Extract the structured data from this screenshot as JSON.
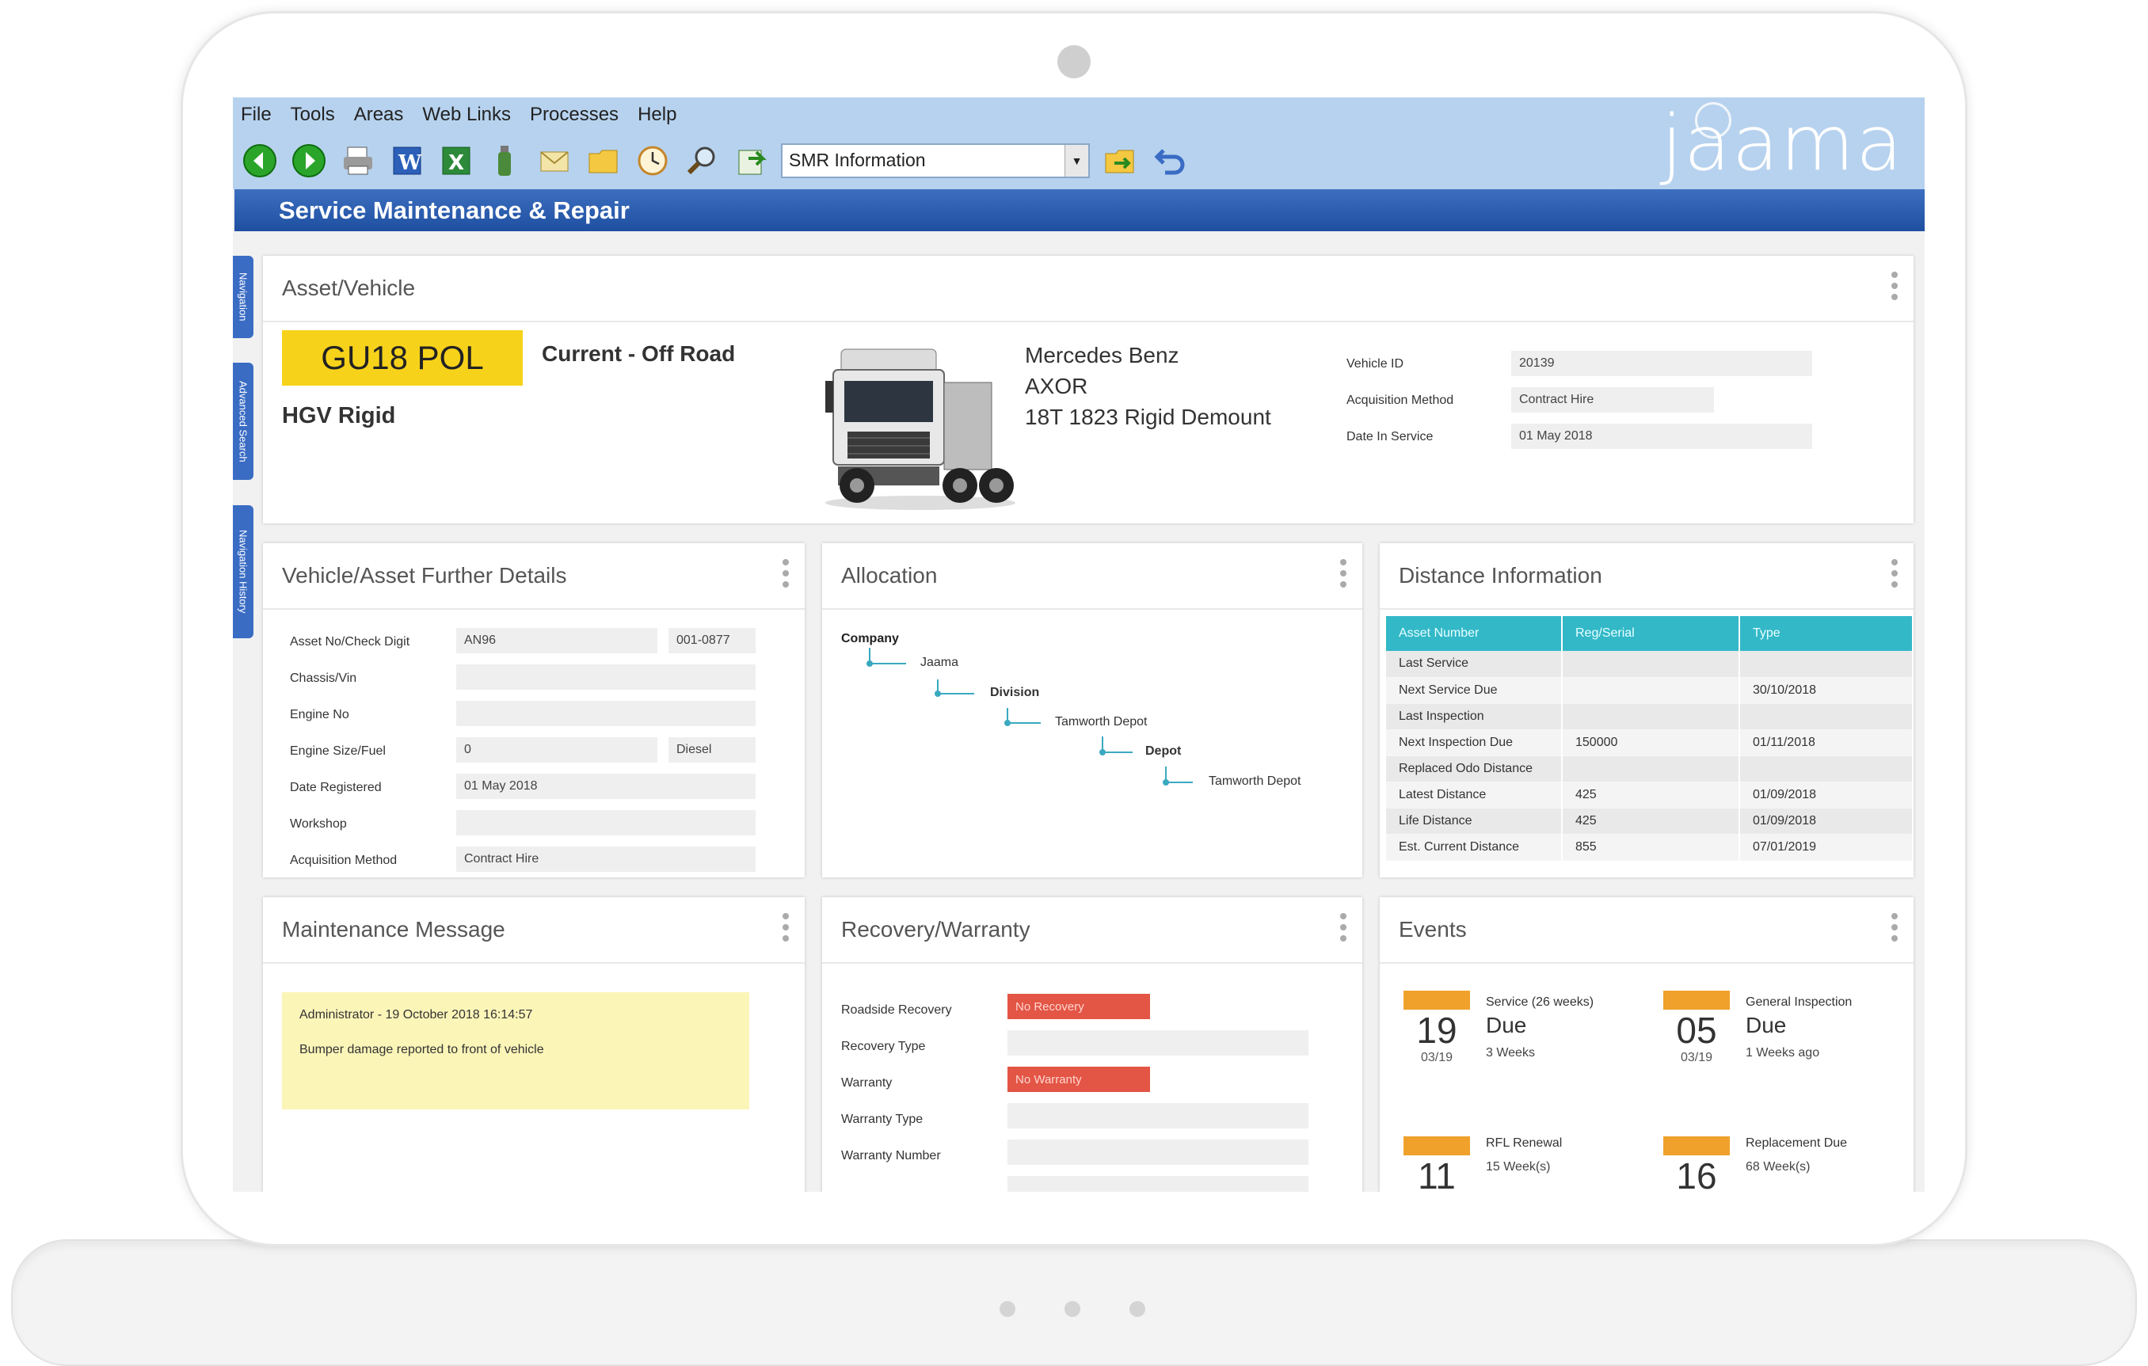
{
  "menu": [
    "File",
    "Tools",
    "Areas",
    "Web Links",
    "Processes",
    "Help"
  ],
  "toolbar": {
    "dropdown_value": "SMR Information",
    "icons": [
      "back-icon",
      "forward-icon",
      "print-icon",
      "word-icon",
      "excel-icon",
      "bottle-icon",
      "envelope-icon",
      "folder-icon",
      "clock-icon",
      "search-icon",
      "refresh-icon",
      "go-icon",
      "undo-icon"
    ]
  },
  "brand": {
    "logo": "jaama"
  },
  "page_title": "Service Maintenance & Repair",
  "sidetabs": [
    "Navigation",
    "Advanced Search",
    "Navigation History"
  ],
  "asset": {
    "title": "Asset/Vehicle",
    "reg": "GU18 POL",
    "status": "Current - Off Road",
    "category": "HGV Rigid",
    "make": "Mercedes Benz",
    "model": "AXOR",
    "variant": "18T 1823 Rigid Demount",
    "fields": [
      {
        "label": "Vehicle ID",
        "value": "20139"
      },
      {
        "label": "Acquisition Method",
        "value": "Contract Hire"
      },
      {
        "label": "Date In Service",
        "value": "01 May 2018"
      }
    ]
  },
  "further": {
    "title": "Vehicle/Asset Further Details",
    "rows": [
      {
        "label": "Asset No/Check Digit",
        "value": "AN96",
        "value2": "001-0877"
      },
      {
        "label": "Chassis/Vin",
        "value": ""
      },
      {
        "label": "Engine No",
        "value": ""
      },
      {
        "label": "Engine Size/Fuel",
        "value": "0",
        "value2": "Diesel"
      },
      {
        "label": "Date Registered",
        "value": "01 May 2018"
      },
      {
        "label": "Workshop",
        "value": ""
      },
      {
        "label": "Acquisition Method",
        "value": "Contract Hire"
      }
    ]
  },
  "allocation": {
    "title": "Allocation",
    "company_label": "Company",
    "company": "Jaama",
    "division_label": "Division",
    "division": "Tamworth Depot",
    "depot_label": "Depot",
    "depot": "Tamworth Depot"
  },
  "distance": {
    "title": "Distance Information",
    "headers": [
      "Asset Number",
      "Reg/Serial",
      "Type"
    ],
    "rows": [
      [
        "Last Service",
        "",
        ""
      ],
      [
        "Next Service Due",
        "",
        "30/10/2018"
      ],
      [
        "Last Inspection",
        "",
        ""
      ],
      [
        "Next Inspection Due",
        "150000",
        "01/11/2018"
      ],
      [
        "Replaced Odo Distance",
        "",
        ""
      ],
      [
        "Latest Distance",
        "425",
        "01/09/2018"
      ],
      [
        "Life Distance",
        "425",
        "01/09/2018"
      ],
      [
        "Est. Current Distance",
        "855",
        "07/01/2019"
      ]
    ]
  },
  "maintenance": {
    "title": "Maintenance Message",
    "author": "Administrator - 19 October 2018 16:14:57",
    "message": "Bumper damage reported to front of vehicle"
  },
  "recovery": {
    "title": "Recovery/Warranty",
    "rows": [
      {
        "label": "Roadside Recovery",
        "value": "No Recovery"
      },
      {
        "label": "Recovery Type",
        "value": ""
      },
      {
        "label": "Warranty",
        "value": "No Warranty"
      },
      {
        "label": "Warranty Type",
        "value": ""
      },
      {
        "label": "Warranty Number",
        "value": ""
      }
    ]
  },
  "events": {
    "title": "Events",
    "items": [
      {
        "day": "19",
        "month": "03/19",
        "title": "Service (26 weeks)",
        "due": "Due",
        "weeks": "3 Weeks"
      },
      {
        "day": "05",
        "month": "03/19",
        "title": "General Inspection",
        "due": "Due",
        "weeks": "1 Weeks ago"
      },
      {
        "day": "11",
        "month": "",
        "title": "RFL Renewal",
        "due": "",
        "weeks": "15 Week(s)"
      },
      {
        "day": "16",
        "month": "",
        "title": "Replacement Due",
        "due": "",
        "weeks": "68 Week(s)"
      }
    ]
  }
}
